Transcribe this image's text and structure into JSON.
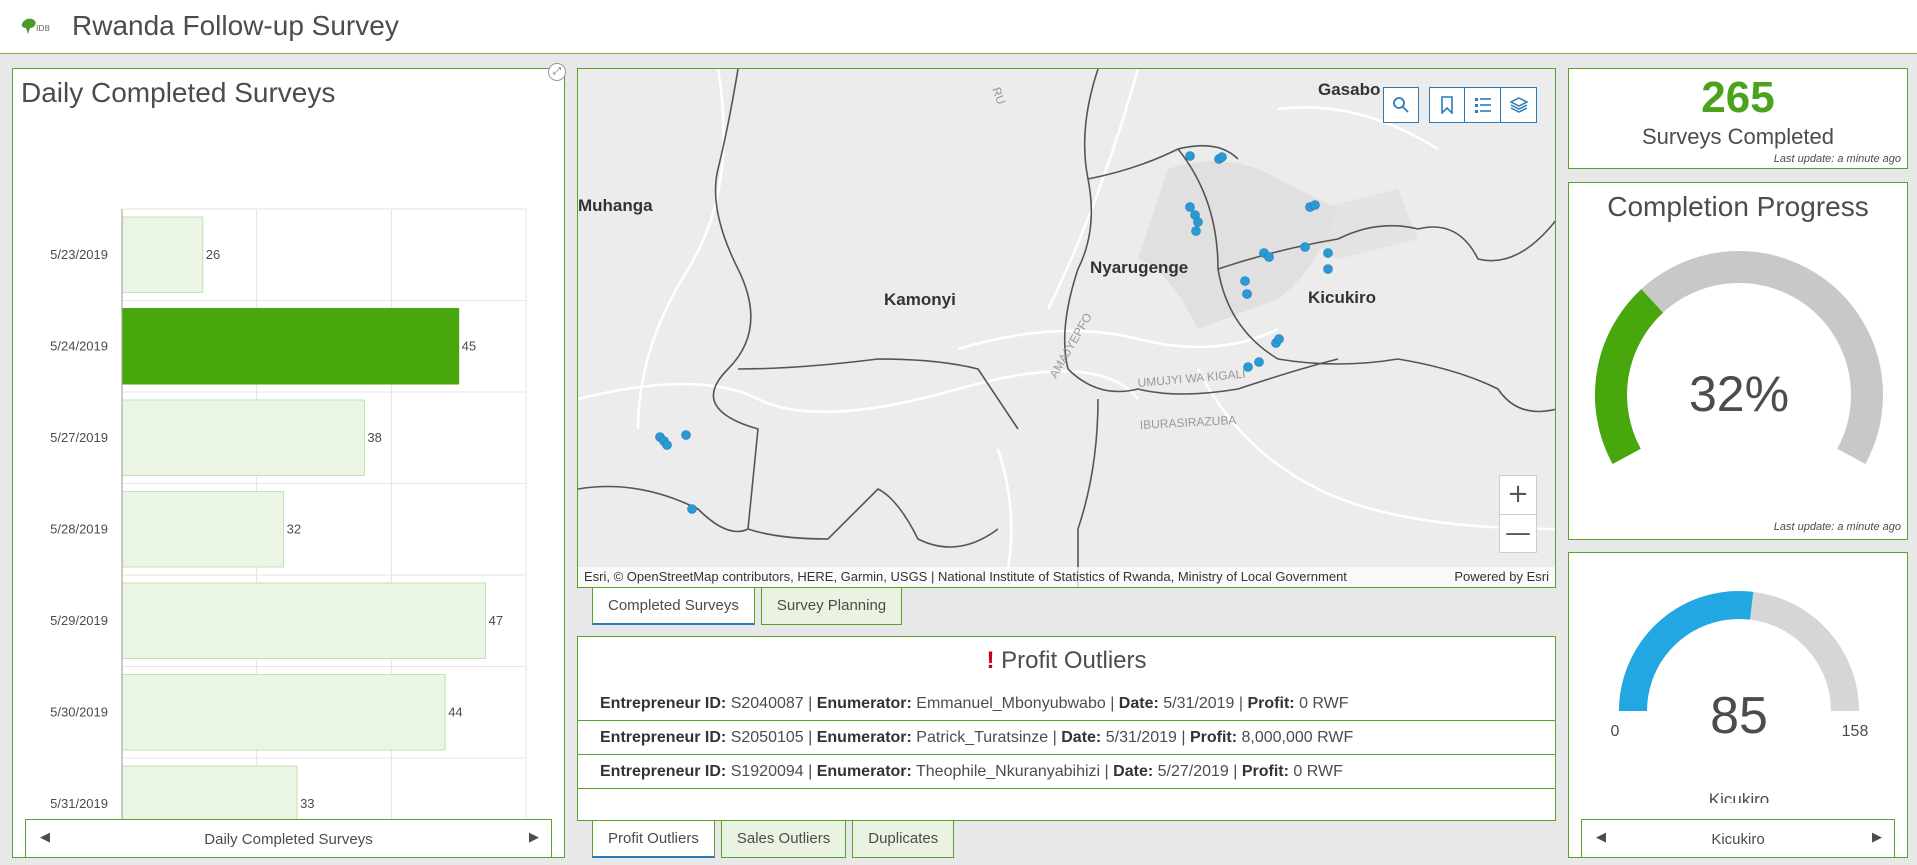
{
  "header": {
    "title": "Rwanda Follow-up Survey"
  },
  "daily_panel": {
    "title": "Daily Completed Surveys",
    "footer_label": "Daily Completed Surveys"
  },
  "chart_data": {
    "type": "bar",
    "orientation": "horizontal",
    "title": "Daily Completed Surveys",
    "categories": [
      "5/23/2019",
      "5/24/2019",
      "5/27/2019",
      "5/28/2019",
      "5/29/2019",
      "5/30/2019",
      "5/31/2019"
    ],
    "values": [
      26,
      45,
      38,
      32,
      47,
      44,
      33
    ],
    "highlighted": "5/24/2019",
    "xlim": [
      20,
      50
    ],
    "xticks": [
      20,
      30,
      40,
      50
    ],
    "colors": {
      "normal_fill": "#eaf5e3",
      "normal_stroke": "#c5e1b5",
      "highlight": "#47a70d"
    }
  },
  "map": {
    "labels": [
      "Gasabo",
      "Muhanga",
      "Nyarugenge",
      "Kamonyi",
      "Kicukiro",
      "UMUJYI WA KIGALI",
      "IBURASIRAZUBA",
      "AMAJYEPFO",
      "RU"
    ],
    "attribution": "Esri, © OpenStreetMap contributors, HERE, Garmin, USGS | National Institute of Statistics of Rwanda, Ministry of Local Government",
    "powered_by": "Powered by Esri",
    "tools": [
      "search-icon",
      "bookmark-icon",
      "legend-icon",
      "layers-icon"
    ],
    "zoom_in": "+",
    "zoom_out": "—",
    "point_color": "#2a9ad7"
  },
  "map_tabs": [
    "Completed Surveys",
    "Survey Planning"
  ],
  "outliers": {
    "title": "Profit Outliers",
    "rows": [
      {
        "id": "S2040087",
        "enumerator": "Emmanuel_Mbonyubwabo",
        "date": "5/31/2019",
        "profit": "0 RWF"
      },
      {
        "id": "S2050105",
        "enumerator": "Patrick_Turatsinze",
        "date": "5/31/2019",
        "profit": "8,000,000 RWF"
      },
      {
        "id": "S1920094",
        "enumerator": "Theophile_Nkuranyabihizi",
        "date": "5/27/2019",
        "profit": "0 RWF"
      }
    ],
    "labels": {
      "id": "Entrepreneur ID:",
      "enumerator": "Enumerator:",
      "date": "Date:",
      "profit": "Profit:"
    }
  },
  "list_tabs": [
    "Profit Outliers",
    "Sales Outliers",
    "Duplicates"
  ],
  "count_indicator": {
    "value": "265",
    "label": "Surveys Completed",
    "last_update": "Last update: a minute ago"
  },
  "progress_gauge": {
    "title": "Completion Progress",
    "value_text": "32%",
    "fraction": 0.32,
    "last_update": "Last update: a minute ago",
    "colors": {
      "fill": "#47a70d",
      "track": "#c8c8c8"
    }
  },
  "district_gauge": {
    "value": "85",
    "min": "0",
    "max": "158",
    "fraction": 0.538,
    "label": "Kicukiro",
    "footer_label": "Kicukiro",
    "colors": {
      "fill": "#22a7e3",
      "track": "#d6d6d6"
    }
  }
}
